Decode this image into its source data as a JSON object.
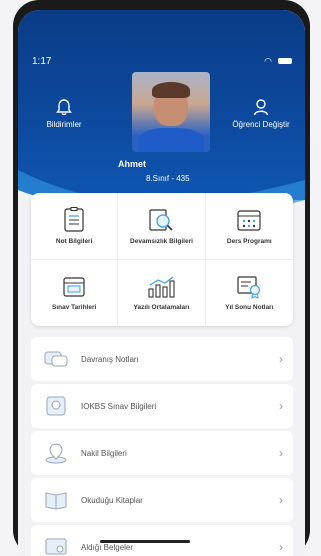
{
  "status": {
    "time": "1:17"
  },
  "header": {
    "notifications_label": "Bildirimler",
    "change_student_label": "Öğrenci Değiştir",
    "student_name": "Ahmet",
    "class_info": "8.Sınıf - 435"
  },
  "grid": [
    {
      "label": "Not Bilgileri",
      "icon": "grades-icon"
    },
    {
      "label": "Devamsızlık Bilgileri",
      "icon": "attendance-icon"
    },
    {
      "label": "Ders Programı",
      "icon": "schedule-icon"
    },
    {
      "label": "Sınav Tarihleri",
      "icon": "exam-dates-icon"
    },
    {
      "label": "Yazılı Ortalamaları",
      "icon": "averages-icon"
    },
    {
      "label": "Yıl Sonu Notları",
      "icon": "year-end-icon"
    }
  ],
  "list": [
    {
      "label": "Davranış Notları",
      "icon": "behavior-icon"
    },
    {
      "label": "IOKBS Sınav Bilgileri",
      "icon": "iokbs-icon"
    },
    {
      "label": "Nakil Bilgileri",
      "icon": "transfer-icon"
    },
    {
      "label": "Okuduğu Kitaplar",
      "icon": "books-icon"
    },
    {
      "label": "Aldığı Belgeler",
      "icon": "certificates-icon"
    }
  ],
  "colors": {
    "header": "#0d4a9f",
    "accent": "#3ea0e6"
  }
}
